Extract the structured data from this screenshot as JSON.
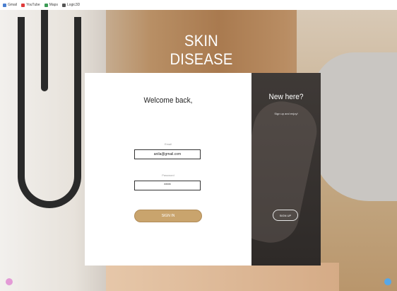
{
  "bookmarks": [
    {
      "label": "Gmail",
      "icon": "gmail-icon",
      "color": "#4a7fd0"
    },
    {
      "label": "YouTube",
      "icon": "youtube-icon",
      "color": "#e03b3b"
    },
    {
      "label": "Maps",
      "icon": "maps-icon",
      "color": "#3b9b55"
    },
    {
      "label": "Logic3D",
      "icon": "logic-icon",
      "color": "#555555"
    }
  ],
  "page": {
    "title": "SKIN DISEASE"
  },
  "login": {
    "heading": "Welcome back,",
    "email_label": "Email",
    "email_value": "anila@gmail.com",
    "password_label": "Password",
    "password_value": "*****",
    "signin_label": "SIGN IN"
  },
  "signup_panel": {
    "heading": "New here?",
    "subtitle": "Sign up and enjoy!",
    "signup_label": "SIGN UP"
  },
  "colors": {
    "accent": "#c9a46d",
    "right_panel": "#3a3533"
  }
}
